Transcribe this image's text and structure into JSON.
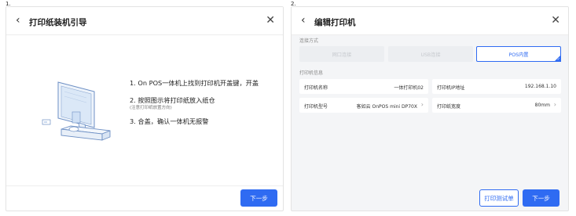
{
  "steps_markers": {
    "first": "1.",
    "second": "2."
  },
  "panel1": {
    "title": "打印纸装机引导",
    "instructions": [
      {
        "text": "1. On POS一体机上找到打印机开盖键，开盖"
      },
      {
        "text": "2. 按照图示将打印纸放入纸仓",
        "note": "(注意打印纸放置方向)"
      },
      {
        "text": "3. 合盖，确认一体机无报警"
      }
    ],
    "next_label": "下一步",
    "icons": {
      "back": "chevron-left-icon",
      "close": "close-icon",
      "illustration": "pos-terminal-illustration"
    }
  },
  "panel2": {
    "title": "编辑打印机",
    "connection": {
      "label": "连接方式",
      "options": [
        {
          "label": "网口连接",
          "state": "disabled"
        },
        {
          "label": "USB连接",
          "state": "disabled"
        },
        {
          "label": "POS内置",
          "state": "selected"
        }
      ]
    },
    "info": {
      "label": "打印机信息",
      "fields": [
        {
          "label": "打印机名称",
          "value": "一体打印机02"
        },
        {
          "label": "打印机IP地址",
          "value": "192.168.1.10"
        },
        {
          "label": "打印机型号",
          "value": "客如云 OnPOS mini DP70X"
        },
        {
          "label": "打印纸宽度",
          "value": "80mm"
        }
      ]
    },
    "test_print_label": "打印测试单",
    "next_label": "下一步",
    "colors": {
      "accent": "#2f6bf2",
      "background": "#f4f5f7"
    }
  }
}
